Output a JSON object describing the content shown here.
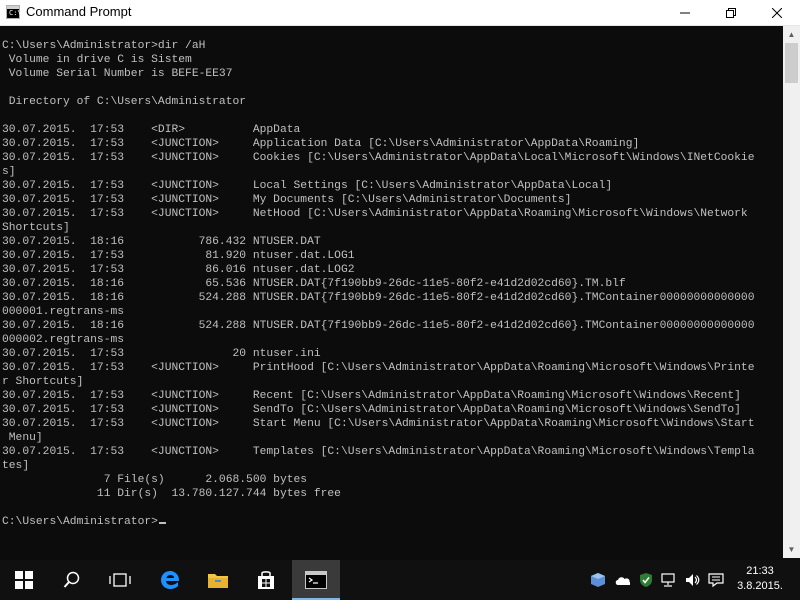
{
  "window": {
    "title": "Command Prompt"
  },
  "console": {
    "lines": [
      "C:\\Users\\Administrator>dir /aH",
      " Volume in drive C is Sistem",
      " Volume Serial Number is BEFE-EE37",
      "",
      " Directory of C:\\Users\\Administrator",
      "",
      "30.07.2015.  17:53    <DIR>          AppData",
      "30.07.2015.  17:53    <JUNCTION>     Application Data [C:\\Users\\Administrator\\AppData\\Roaming]",
      "30.07.2015.  17:53    <JUNCTION>     Cookies [C:\\Users\\Administrator\\AppData\\Local\\Microsoft\\Windows\\INetCookie",
      "s]",
      "30.07.2015.  17:53    <JUNCTION>     Local Settings [C:\\Users\\Administrator\\AppData\\Local]",
      "30.07.2015.  17:53    <JUNCTION>     My Documents [C:\\Users\\Administrator\\Documents]",
      "30.07.2015.  17:53    <JUNCTION>     NetHood [C:\\Users\\Administrator\\AppData\\Roaming\\Microsoft\\Windows\\Network",
      "Shortcuts]",
      "30.07.2015.  18:16           786.432 NTUSER.DAT",
      "30.07.2015.  17:53            81.920 ntuser.dat.LOG1",
      "30.07.2015.  17:53            86.016 ntuser.dat.LOG2",
      "30.07.2015.  18:16            65.536 NTUSER.DAT{7f190bb9-26dc-11e5-80f2-e41d2d02cd60}.TM.blf",
      "30.07.2015.  18:16           524.288 NTUSER.DAT{7f190bb9-26dc-11e5-80f2-e41d2d02cd60}.TMContainer00000000000000",
      "000001.regtrans-ms",
      "30.07.2015.  18:16           524.288 NTUSER.DAT{7f190bb9-26dc-11e5-80f2-e41d2d02cd60}.TMContainer00000000000000",
      "000002.regtrans-ms",
      "30.07.2015.  17:53                20 ntuser.ini",
      "30.07.2015.  17:53    <JUNCTION>     PrintHood [C:\\Users\\Administrator\\AppData\\Roaming\\Microsoft\\Windows\\Printe",
      "r Shortcuts]",
      "30.07.2015.  17:53    <JUNCTION>     Recent [C:\\Users\\Administrator\\AppData\\Roaming\\Microsoft\\Windows\\Recent]",
      "30.07.2015.  17:53    <JUNCTION>     SendTo [C:\\Users\\Administrator\\AppData\\Roaming\\Microsoft\\Windows\\SendTo]",
      "30.07.2015.  17:53    <JUNCTION>     Start Menu [C:\\Users\\Administrator\\AppData\\Roaming\\Microsoft\\Windows\\Start",
      " Menu]",
      "30.07.2015.  17:53    <JUNCTION>     Templates [C:\\Users\\Administrator\\AppData\\Roaming\\Microsoft\\Windows\\Templa",
      "tes]",
      "               7 File(s)      2.068.500 bytes",
      "              11 Dir(s)  13.780.127.744 bytes free",
      "",
      "C:\\Users\\Administrator>"
    ]
  },
  "taskbar": {
    "clock_time": "21:33",
    "clock_date": "3.8.2015."
  },
  "colors": {
    "console_background": "#0c0c0c",
    "console_text": "#c0c0c0",
    "taskbar_background": "#101010",
    "edge_blue": "#1e90ff",
    "explorer_yellow": "#f4c542"
  }
}
